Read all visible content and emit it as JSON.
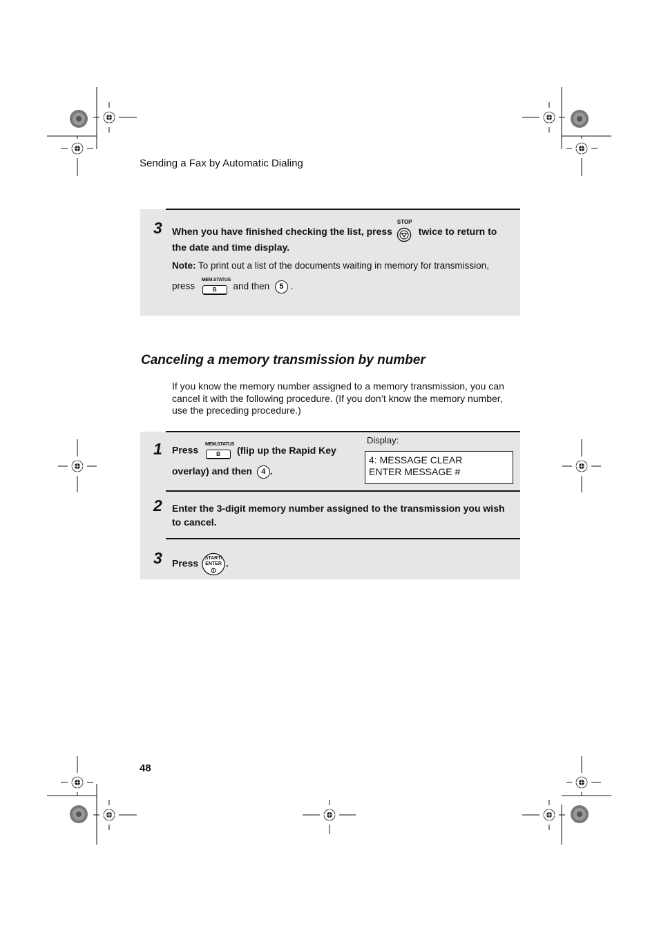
{
  "header": {
    "title": "Sending a Fax by Automatic Dialing"
  },
  "top_panel": {
    "step_number": "3",
    "line1_a": "When you have finished checking the list, press",
    "stop_key_label": "STOP",
    "line1_b": "twice to return to",
    "line2": "the date and time display.",
    "note_label": "Note:",
    "note_text": "To print out a list of the documents waiting in memory for transmission,",
    "note_press": "press",
    "mem_status_label": "MEM.STATUS",
    "mem_status_key": "B",
    "note_and_then": "and then",
    "note_digit": "5",
    "note_end": "."
  },
  "section": {
    "title": "Canceling a memory transmission by number",
    "intro": "If you know the memory number assigned to a memory transmission, you can cancel it with the following procedure. (If you don’t know the memory number, use the preceding procedure.)"
  },
  "steps": [
    {
      "number": "1",
      "press": "Press",
      "mem_status_label": "MEM.STATUS",
      "mem_status_key": "B",
      "text_a": "(flip up the Rapid Key",
      "text_b": "overlay) and then",
      "digit": "4",
      "end": ".",
      "display_label": "Display:",
      "display_line1": "4: MESSAGE CLEAR",
      "display_line2": "ENTER MESSAGE #"
    },
    {
      "number": "2",
      "text": "Enter the 3-digit memory number assigned to the transmission you wish to cancel."
    },
    {
      "number": "3",
      "press": "Press",
      "key_line1": "START/",
      "key_line2": "ENTER",
      "end": "."
    }
  ],
  "footer": {
    "page_number": "48"
  }
}
